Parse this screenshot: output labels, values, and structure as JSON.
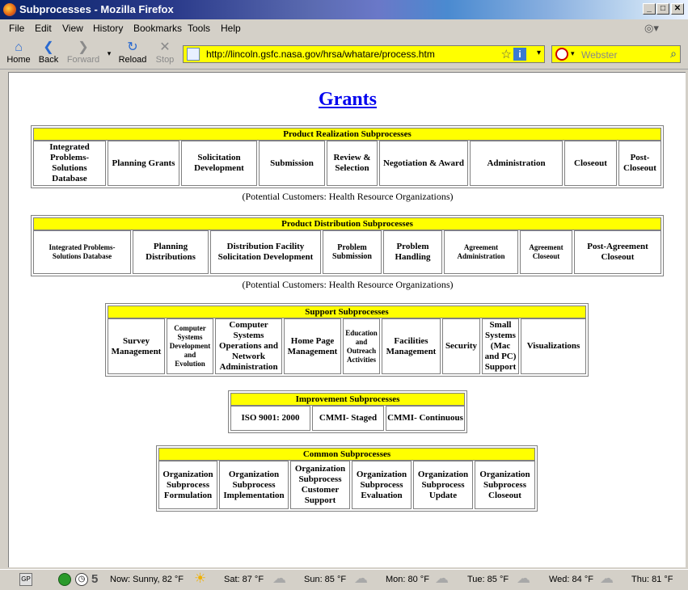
{
  "window": {
    "title": "Subprocesses - Mozilla Firefox"
  },
  "menu": [
    "File",
    "Edit",
    "View",
    "History",
    "Bookmarks",
    "Tools",
    "Help"
  ],
  "toolbar": {
    "home": "Home",
    "back": "Back",
    "forward": "Forward",
    "reload": "Reload",
    "stop": "Stop",
    "url": "http://lincoln.gsfc.nasa.gov/hrsa/whatare/process.htm",
    "search_placeholder": "Webster"
  },
  "page": {
    "heading": "Grants",
    "groups": [
      {
        "title": "Product Realization Subprocesses",
        "cells": [
          "Integrated Problems-Solutions Database",
          "Planning Grants",
          "Solicitation Development",
          "Submission",
          "Review & Selection",
          "Negotiation & Award",
          "Administration",
          "Closeout",
          "Post-Closeout"
        ]
      },
      {
        "title": "Product Distribution Subprocesses",
        "cells": [
          "Integrated Problems-Solutions Database",
          "Planning Distributions",
          "Distribution Facility Solicitation Development",
          "Problem Submission",
          "Problem Handling",
          "Agreement Administration",
          "Agreement Closeout",
          "Post-Agreement Closeout"
        ]
      },
      {
        "title": "Support Subprocesses",
        "cells": [
          "Survey Management",
          "Computer Systems Development and Evolution",
          "Computer Systems Operations and Network Administration",
          "Home Page Management",
          "Education and Outreach Activities",
          "Facilities Management",
          "Security",
          "Small Systems (Mac and PC) Support",
          "Visualizations"
        ]
      },
      {
        "title": "Improvement Subprocesses",
        "cells": [
          "ISO 9001: 2000",
          "CMMI- Staged",
          "CMMI- Continuous"
        ]
      },
      {
        "title": "Common Subprocesses",
        "cells": [
          "Organization Subprocess Formulation",
          "Organization Subprocess Implementation",
          "Organization Subprocess Customer Support",
          "Organization Subprocess Evaluation",
          "Organization Subprocess Update",
          "Organization Subprocess Closeout"
        ]
      }
    ],
    "note1": "(Potential Customers: Health Resource Organizations)",
    "note2": "(Potential Customers: Health Resource Organizations)"
  },
  "status": {
    "gp": "GP",
    "counter": "5",
    "weather": [
      {
        "label": "Now: Sunny, 82 °F",
        "icon": "sun-icon"
      },
      {
        "label": "Sat: 87 °F",
        "icon": "partly-cloudy-icon"
      },
      {
        "label": "Sun: 85 °F",
        "icon": "cloudy-icon"
      },
      {
        "label": "Mon: 80 °F",
        "icon": "partly-cloudy-icon"
      },
      {
        "label": "Tue: 85 °F",
        "icon": "partly-cloudy-icon"
      },
      {
        "label": "Wed: 84 °F",
        "icon": "cloudy-icon"
      },
      {
        "label": "Thu: 81 °F",
        "icon": "partly-cloudy-icon"
      }
    ]
  },
  "colors": {
    "header_fill": "#ffff00",
    "link": "#0000ee",
    "urlbar_fill": "#ffff00"
  }
}
